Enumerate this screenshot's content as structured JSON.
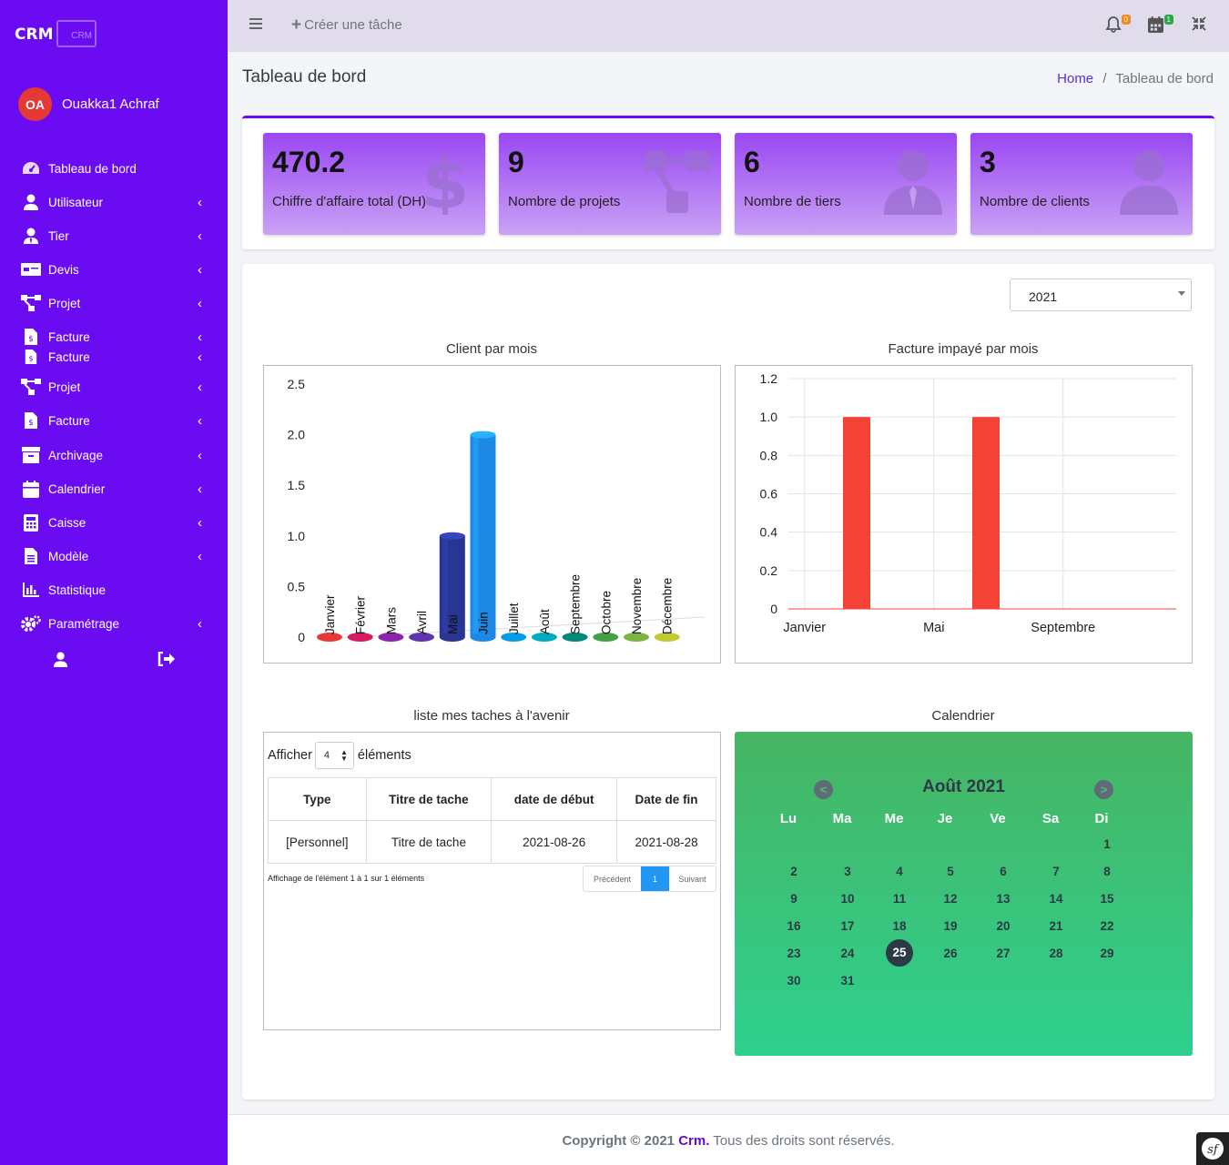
{
  "brand": {
    "name": "CRM",
    "logo_text": "CRM"
  },
  "user": {
    "initials": "OA",
    "name": "Ouakka1 Achraf"
  },
  "sidebar": {
    "items": [
      {
        "label": "Tableau de bord",
        "icon": "dashboard-icon"
      },
      {
        "label": "Utilisateur",
        "icon": "user-icon"
      },
      {
        "label": "Tier",
        "icon": "user-tie-icon"
      },
      {
        "label": "Devis",
        "icon": "money-bill-icon"
      },
      {
        "label": "Projet",
        "icon": "project-diagram-icon"
      },
      {
        "label": "Facture",
        "icon": "invoice-icon"
      },
      {
        "label": "Facture",
        "icon": "invoice-icon"
      },
      {
        "label": "Projet",
        "icon": "project-diagram-icon"
      },
      {
        "label": "Facture",
        "icon": "invoice-icon"
      },
      {
        "label": "Archivage",
        "icon": "archive-icon"
      },
      {
        "label": "Calendrier",
        "icon": "calendar-icon"
      },
      {
        "label": "Caisse",
        "icon": "calculator-icon"
      },
      {
        "label": "Modèle",
        "icon": "file-icon"
      },
      {
        "label": "Statistique",
        "icon": "chart-bar-icon"
      },
      {
        "label": "Paramétrage",
        "icon": "cogs-icon"
      }
    ]
  },
  "topbar": {
    "create_label": "Créer une tâche",
    "notifications_count": "0",
    "events_count": "1"
  },
  "page": {
    "title": "Tableau de bord"
  },
  "breadcrumb": {
    "home": "Home",
    "separator": "/",
    "current": "Tableau de bord"
  },
  "stats": [
    {
      "value": "470.2",
      "label": "Chiffre d'affaire total (DH)",
      "icon": "dollar-icon"
    },
    {
      "value": "9",
      "label": "Nombre de projets",
      "icon": "project-diagram-icon"
    },
    {
      "value": "6",
      "label": "Nombre de tiers",
      "icon": "user-tie-icon"
    },
    {
      "value": "3",
      "label": "Nombre de clients",
      "icon": "user-icon"
    }
  ],
  "year_select": {
    "value": "2021"
  },
  "chart_data": [
    {
      "type": "bar",
      "title": "Client par mois",
      "categories": [
        "Janvier",
        "Février",
        "Mars",
        "Avril",
        "Mai",
        "Juin",
        "Juillet",
        "Août",
        "Septembre",
        "Octobre",
        "Novembre",
        "Décembre"
      ],
      "values": [
        0,
        0,
        0,
        0,
        1,
        2,
        0,
        0,
        0,
        0,
        0,
        0
      ],
      "colors": [
        "#e53935",
        "#d81b60",
        "#8e24aa",
        "#5e35b1",
        "#283593",
        "#1e88e5",
        "#039be5",
        "#00acc1",
        "#00897b",
        "#43a047",
        "#7cb342",
        "#c0ca33"
      ],
      "yticks": [
        "0",
        "0.5",
        "1.0",
        "1.5",
        "2.0",
        "2.5"
      ],
      "ylim": [
        0,
        2.5
      ]
    },
    {
      "type": "bar",
      "title": "Facture impayé par mois",
      "categories": [
        "Janvier",
        "Février",
        "Mars",
        "Avril",
        "Mai",
        "Juin",
        "Juillet",
        "Août",
        "Septembre",
        "Octobre",
        "Novembre",
        "Décembre"
      ],
      "values": [
        0,
        1,
        0,
        0,
        0,
        1,
        0,
        0,
        0,
        0,
        0,
        0
      ],
      "color": "#f44336",
      "xticks": [
        "Janvier",
        "Mai",
        "Septembre"
      ],
      "yticks": [
        "0",
        "0.2",
        "0.4",
        "0.6",
        "0.8",
        "1.0",
        "1.2"
      ],
      "ylim": [
        0,
        1.2
      ],
      "grid": true
    }
  ],
  "tasks": {
    "title": "liste mes taches à l'avenir",
    "show_label": "Afficher",
    "entries_value": "4",
    "entries_suffix": "éléments",
    "columns": [
      "Type",
      "Titre de tache",
      "date de début",
      "Date de fin"
    ],
    "rows": [
      [
        "[Personnel]",
        "Titre de tache",
        "2021-08-26",
        "2021-08-28"
      ]
    ],
    "info": "Affichage de l'élément 1 à 1 sur 1 éléments",
    "prev": "Précédent",
    "page": "1",
    "next": "Suivant"
  },
  "calendar": {
    "title": "Calendrier",
    "month": "Août 2021",
    "prev": "<",
    "next": ">",
    "weekdays": [
      "Lu",
      "Ma",
      "Me",
      "Je",
      "Ve",
      "Sa",
      "Di"
    ],
    "days": [
      "1",
      "2",
      "3",
      "4",
      "5",
      "6",
      "7",
      "8",
      "9",
      "10",
      "11",
      "12",
      "13",
      "14",
      "15",
      "16",
      "17",
      "18",
      "19",
      "20",
      "21",
      "22",
      "23",
      "24",
      "25",
      "26",
      "27",
      "28",
      "29",
      "30",
      "31"
    ],
    "first_weekday_index": 6,
    "today": "25"
  },
  "footer": {
    "copyright": "Copyright © 2021",
    "brand": "Crm.",
    "rights": "Tous des droits sont réservés."
  }
}
